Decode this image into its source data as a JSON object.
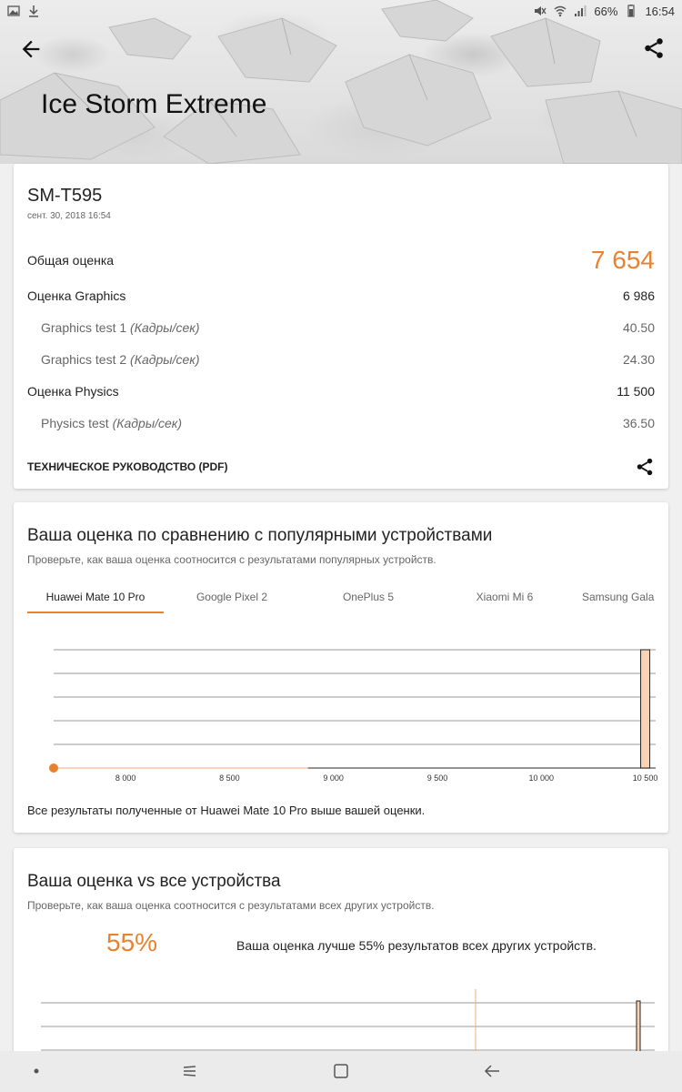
{
  "status": {
    "battery": "66%",
    "time": "16:54"
  },
  "header": {
    "title": "Ice Storm Extreme"
  },
  "result": {
    "device": "SM-T595",
    "date": "сент. 30, 2018 16:54",
    "overall_label": "Общая оценка",
    "overall_value": "7 654",
    "graphics_label": "Оценка Graphics",
    "graphics_value": "6 986",
    "gt1_label": "Graphics test 1",
    "gt1_unit": "(Кадры/сек)",
    "gt1_value": "40.50",
    "gt2_label": "Graphics test 2",
    "gt2_unit": "(Кадры/сек)",
    "gt2_value": "24.30",
    "physics_label": "Оценка Physics",
    "physics_value": "11 500",
    "pt_label": "Physics test",
    "pt_unit": "(Кадры/сек)",
    "pt_value": "36.50",
    "manual_label": "ТЕХНИЧЕСКОЕ РУКОВОДСТВО (PDF)"
  },
  "compare": {
    "title": "Ваша оценка по сравнению с популярными устройствами",
    "subtitle": "Проверьте, как ваша оценка соотносится с результатами популярных устройств.",
    "tabs": [
      "Huawei Mate 10 Pro",
      "Google Pixel 2",
      "OnePlus 5",
      "Xiaomi Mi 6",
      "Samsung Gala"
    ],
    "note": "Все результаты полученные от Huawei Mate 10 Pro выше вашей оценки."
  },
  "chart_data": {
    "type": "bar",
    "x_ticks": [
      "8 000",
      "8 500",
      "9 000",
      "9 500",
      "10 000",
      "10 500"
    ],
    "tick_values": [
      8000,
      8500,
      9000,
      9500,
      10000,
      10500
    ],
    "xlim": [
      7654,
      10550
    ],
    "your_score": 7654,
    "bars": [
      {
        "x": 10500,
        "height": 1.0
      }
    ],
    "grid": true
  },
  "vs_all": {
    "title": "Ваша оценка vs все устройства",
    "subtitle": "Проверьте, как ваша оценка соотносится с результатами всех других устройств.",
    "percent": "55%",
    "percent_text": "Ваша оценка лучше 55% результатов всех других устройств."
  },
  "colors": {
    "accent": "#e8822f",
    "bar_fill": "#f9d3b3"
  }
}
